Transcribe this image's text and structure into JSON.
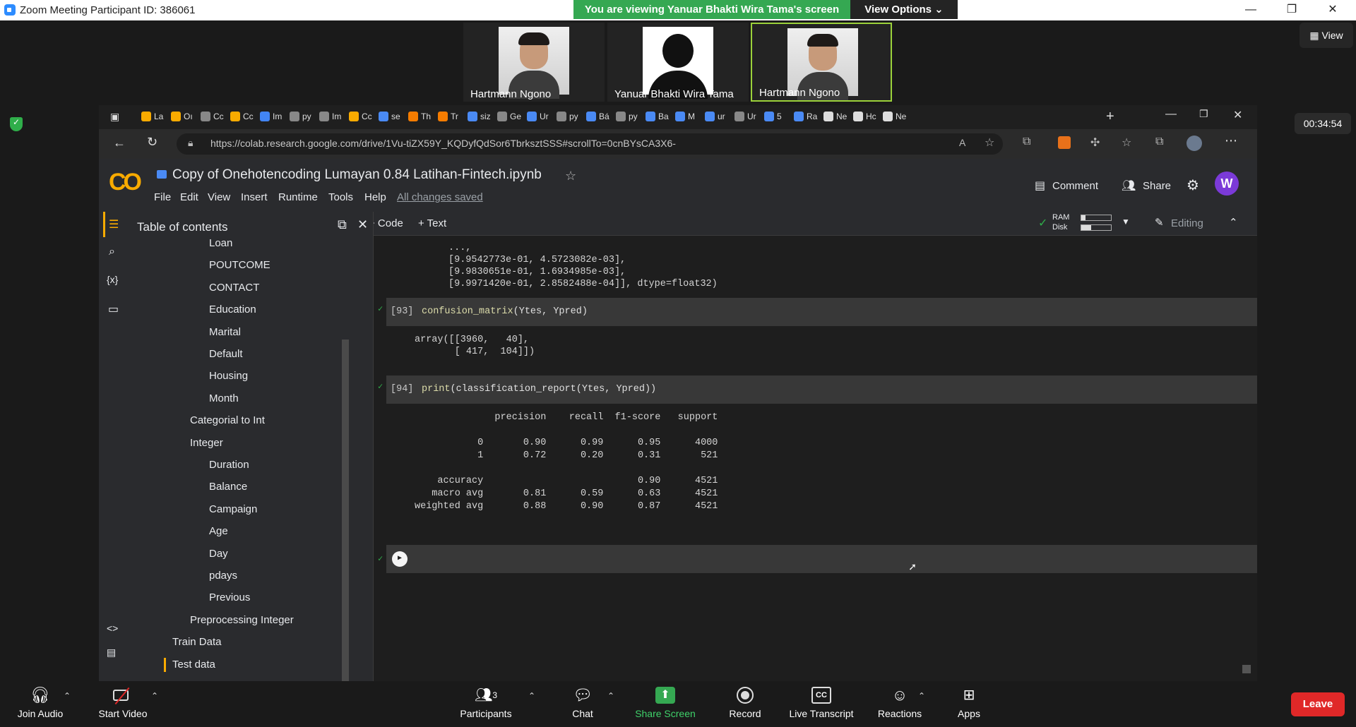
{
  "zoom": {
    "window_title": "Zoom Meeting Participant ID: 386061",
    "banner": "You are viewing Yanuar Bhakti Wira Tama's screen",
    "view_options": "View Options ⌄",
    "view_button": "View",
    "timer": "00:34:54",
    "participants": [
      {
        "name": "Hartmann Ngono"
      },
      {
        "name": "Yanuar Bhakti Wira Tama"
      },
      {
        "name": "Hartmann Ngono"
      }
    ],
    "toolbar": {
      "join_audio": "Join Audio",
      "start_video": "Start Video",
      "participants": "Participants",
      "participants_count": "3",
      "chat": "Chat",
      "share_screen": "Share Screen",
      "record": "Record",
      "live_transcript": "Live Transcript",
      "reactions": "Reactions",
      "apps": "Apps",
      "leave": "Leave"
    },
    "colors": {
      "accent_green": "#35a852",
      "leave_red": "#e02828"
    }
  },
  "browser": {
    "url": "https://colab.research.google.com/drive/1Vu-tiZX59Y_KQDyfQdSor6TbrksztSSS#scrollTo=0cnBYsCA3X6-",
    "tabs": [
      "La",
      "Oı",
      "Cc",
      "Cc",
      "Im",
      "py",
      "Im",
      "Cc",
      "se",
      "Th",
      "Tr",
      "siz",
      "Ge",
      "Ur",
      "py",
      "Bá",
      "py",
      "Ba",
      "M",
      "ur",
      "Ur",
      "5",
      "Ra",
      "Ne",
      "Hc",
      "Ne"
    ]
  },
  "colab": {
    "notebook_title": "Copy of Onehotencoding Lumayan 0.84 Latihan-Fintech.ipynb",
    "menu": [
      "File",
      "Edit",
      "View",
      "Insert",
      "Runtime",
      "Tools",
      "Help"
    ],
    "saved_status": "All changes saved",
    "comment": "Comment",
    "share": "Share",
    "avatar_letter": "W",
    "add_code": "+ Code",
    "add_text": "+ Text",
    "ram_label": "RAM",
    "disk_label": "Disk",
    "editing": "Editing",
    "toc_title": "Table of contents",
    "toc_items": [
      {
        "label": "Loan",
        "level": 3
      },
      {
        "label": "POUTCOME",
        "level": 3
      },
      {
        "label": "CONTACT",
        "level": 3
      },
      {
        "label": "Education",
        "level": 3
      },
      {
        "label": "Marital",
        "level": 3
      },
      {
        "label": "Default",
        "level": 3
      },
      {
        "label": "Housing",
        "level": 3
      },
      {
        "label": "Month",
        "level": 3
      },
      {
        "label": "Categorial to Int",
        "level": 2
      },
      {
        "label": "Integer",
        "level": 2
      },
      {
        "label": "Duration",
        "level": 3
      },
      {
        "label": "Balance",
        "level": 3
      },
      {
        "label": "Campaign",
        "level": 3
      },
      {
        "label": "Age",
        "level": 3
      },
      {
        "label": "Day",
        "level": 3
      },
      {
        "label": "pdays",
        "level": 3
      },
      {
        "label": "Previous",
        "level": 3
      },
      {
        "label": "Preprocessing Integer",
        "level": 2
      },
      {
        "label": "Train Data",
        "level": 1
      },
      {
        "label": "Test data",
        "level": 1
      }
    ],
    "output_top": [
      "...,",
      "[9.9542773e-01, 4.5723082e-03],",
      "[9.9830651e-01, 1.6934985e-03],",
      "[9.9971420e-01, 2.8582488e-04]], dtype=float32)"
    ],
    "cell93": {
      "num": "[93]",
      "fn": "confusion_matrix",
      "args": "(Ytes, Ypred)",
      "output": [
        "array([[3960,   40],",
        "       [ 417,  104]])"
      ]
    },
    "cell94": {
      "num": "[94]",
      "fn": "print",
      "args": "(classification_report(Ytes, Ypred))",
      "output": [
        "              precision    recall  f1-score   support",
        "",
        "           0       0.90      0.99      0.95      4000",
        "           1       0.72      0.20      0.31       521",
        "",
        "    accuracy                           0.90      4521",
        "   macro avg       0.81      0.59      0.63      4521",
        "weighted avg       0.88      0.90      0.87      4521"
      ]
    }
  }
}
